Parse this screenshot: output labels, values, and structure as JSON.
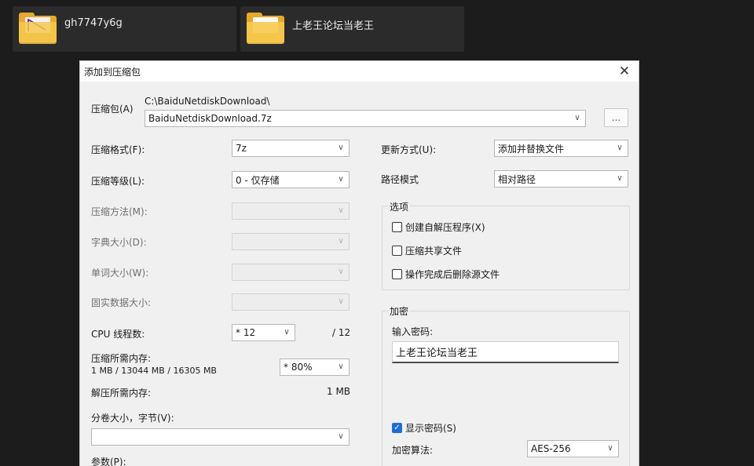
{
  "folders": [
    {
      "name": "gh7747y6g"
    },
    {
      "name": "上老王论坛当老王"
    }
  ],
  "dialog": {
    "title": "添加到压缩包",
    "close_glyph": "✕",
    "archive": {
      "label": "压缩包(A)",
      "path": "C:\\BaiduNetdiskDownload\\",
      "filename": "BaiduNetdiskDownload.7z",
      "browse_label": "..."
    },
    "left": {
      "format": {
        "label": "压缩格式(F):",
        "value": "7z"
      },
      "level": {
        "label": "压缩等级(L):",
        "value": "0 - 仅存储"
      },
      "method": {
        "label": "压缩方法(M):",
        "value": ""
      },
      "dict": {
        "label": "字典大小(D):",
        "value": ""
      },
      "word": {
        "label": "单词大小(W):",
        "value": ""
      },
      "solid": {
        "label": "固实数据大小:",
        "value": ""
      },
      "cpu": {
        "label": "CPU 线程数:",
        "value": "* 12",
        "max": "/ 12"
      },
      "memory": {
        "label": "压缩所需内存:",
        "detail": "1 MB / 13044 MB / 16305 MB",
        "value": "* 80%"
      },
      "decompress": {
        "label": "解压所需内存:",
        "value": "1 MB"
      },
      "volume": {
        "label": "分卷大小，字节(V):",
        "value": ""
      },
      "params": {
        "label": "参数(P):"
      }
    },
    "right": {
      "update": {
        "label": "更新方式(U):",
        "value": "添加并替换文件"
      },
      "pathmode": {
        "label": "路径模式",
        "value": "相对路径"
      },
      "options": {
        "title": "选项",
        "items": [
          {
            "label": "创建自解压程序(X)",
            "checked": false
          },
          {
            "label": "压缩共享文件",
            "checked": false
          },
          {
            "label": "操作完成后删除源文件",
            "checked": false
          }
        ]
      },
      "encryption": {
        "title": "加密",
        "password_label": "输入密码:",
        "password_value": "上老王论坛当老王",
        "show_password": {
          "label": "显示密码(S)",
          "checked": true
        },
        "algorithm": {
          "label": "加密算法:",
          "value": "AES-256"
        }
      }
    }
  }
}
